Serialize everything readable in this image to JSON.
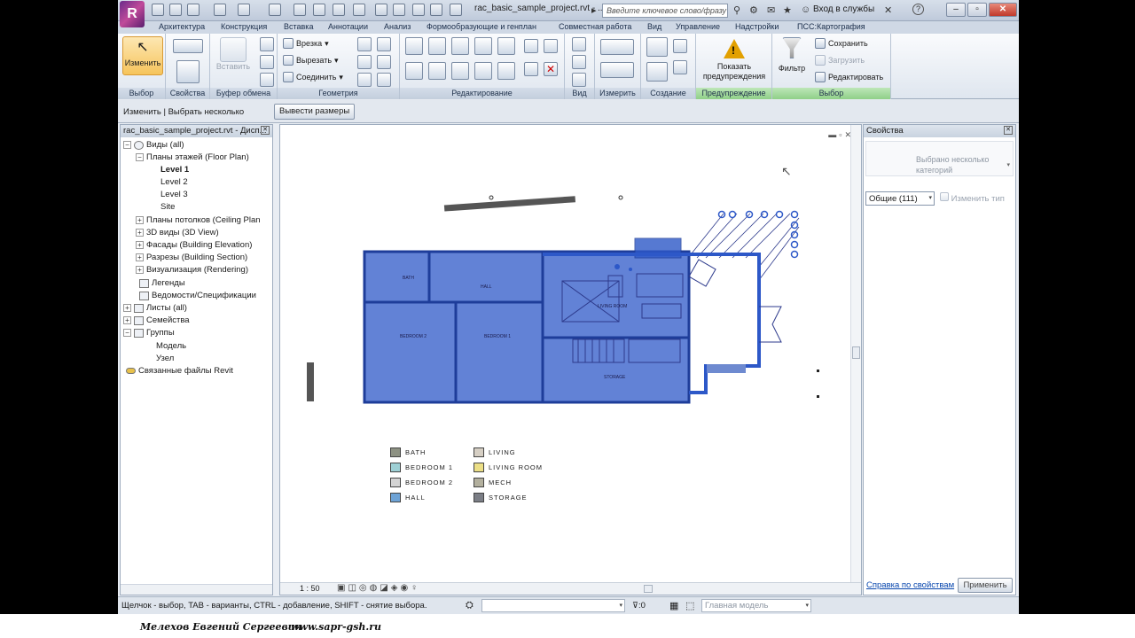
{
  "title_bar": {
    "document_title": "rac_basic_sample_project.rvt - ...",
    "search_placeholder": "Введите ключевое слово/фразу",
    "login": "Вход в службы",
    "help": "?"
  },
  "menu_tabs": [
    "Архитектура",
    "Конструкция",
    "Вставка",
    "Аннотации",
    "Анализ",
    "Формообразующие и генплан",
    "Совместная работа",
    "Вид",
    "Управление",
    "Надстройки",
    "ПСС:Картография"
  ],
  "ribbon": {
    "modify": {
      "label": "Изменить",
      "panel": "Выбор"
    },
    "properties_panel": "Свойства",
    "clipboard": {
      "paste": "Вставить",
      "panel": "Буфер обмена"
    },
    "geometry": {
      "cope": "Врезка",
      "cut": "Вырезать",
      "join": "Соединить",
      "panel": "Геометрия"
    },
    "edit_panel": "Редактирование",
    "view_panel": "Вид",
    "measure_panel": "Измерить",
    "create_panel": "Создание",
    "warnings": {
      "label": "Показать предупреждения",
      "panel": "Предупреждение"
    },
    "filter": {
      "label": "Фильтр"
    },
    "selection": {
      "save": "Сохранить",
      "load": "Загрузить",
      "edit": "Редактировать",
      "panel": "Выбор"
    }
  },
  "options_bar": {
    "label": "Изменить | Выбрать несколько",
    "button": "Вывести размеры"
  },
  "project_browser": {
    "title": "rac_basic_sample_project.rvt - Дисп...",
    "items": [
      {
        "label": "Виды (all)"
      },
      {
        "label": "Планы этажей (Floor Plan)"
      },
      {
        "label": "Level 1"
      },
      {
        "label": "Level 2"
      },
      {
        "label": "Level 3"
      },
      {
        "label": "Site"
      },
      {
        "label": "Планы потолков (Ceiling Plan"
      },
      {
        "label": "3D виды (3D View)"
      },
      {
        "label": "Фасады (Building Elevation)"
      },
      {
        "label": "Разрезы (Building Section)"
      },
      {
        "label": "Визуализация (Rendering)"
      },
      {
        "label": "Легенды"
      },
      {
        "label": "Ведомости/Спецификации"
      },
      {
        "label": "Листы (all)"
      },
      {
        "label": "Семейства"
      },
      {
        "label": "Группы"
      },
      {
        "label": "Модель"
      },
      {
        "label": "Узел"
      },
      {
        "label": "Связанные файлы Revit"
      }
    ]
  },
  "canvas": {
    "scale": "1 : 50",
    "room_tags": [
      "BATH",
      "HALL",
      "BEDROOM 2",
      "BEDROOM 1",
      "LIVING ROOM",
      "STORAGE"
    ],
    "legend": [
      {
        "label": "BATH",
        "color": "#8d9182"
      },
      {
        "label": "BEDROOM 1",
        "color": "#9ed0d5"
      },
      {
        "label": "BEDROOM 2",
        "color": "#d3d3d3"
      },
      {
        "label": "HALL",
        "color": "#6ea3d6"
      },
      {
        "label": "LIVING",
        "color": "#d6cfc4"
      },
      {
        "label": "LIVING ROOM",
        "color": "#ecdf86"
      },
      {
        "label": "MECH",
        "color": "#b3b09e"
      },
      {
        "label": "STORAGE",
        "color": "#7b7e86"
      }
    ]
  },
  "properties": {
    "title": "Свойства",
    "type_text": "Выбрано несколько категорий",
    "selection_combo": "Общие (111)",
    "edit_type": "Изменить тип",
    "help_link": "Справка по свойствам",
    "apply": "Применить"
  },
  "status_bar": {
    "hint": "Щелчок - выбор, TAB - варианты, CTRL - добавление, SHIFT - снятие выбора.",
    "filter_count": ":0",
    "model": "Главная модель"
  },
  "footer": {
    "author": "Мелехов Евгений Сергеевич",
    "site": "www.sapr-gsh.ru"
  },
  "colors": {
    "selection_blue": "#2d58c8",
    "ribbon_bg": "#dfe6ef"
  }
}
